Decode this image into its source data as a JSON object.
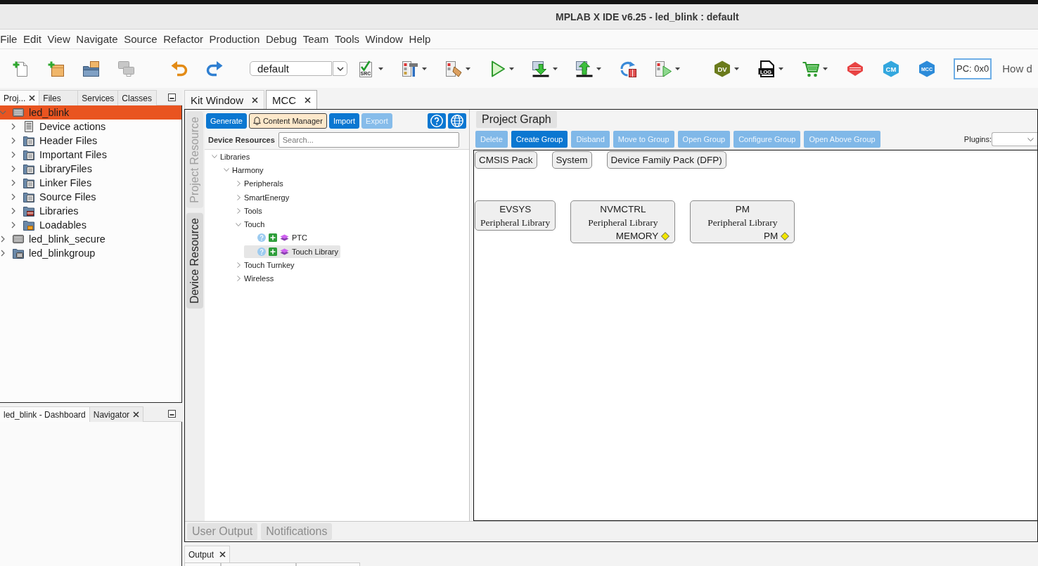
{
  "window": {
    "title": "MPLAB X IDE v6.25 - led_blink : default"
  },
  "menu": [
    "File",
    "Edit",
    "View",
    "Navigate",
    "Source",
    "Refactor",
    "Production",
    "Debug",
    "Team",
    "Tools",
    "Window",
    "Help"
  ],
  "toolbar": {
    "groups": [
      [
        {
          "kind": "new-file",
          "menu": false,
          "disabled": false
        },
        {
          "kind": "new-project",
          "menu": false,
          "disabled": false
        },
        {
          "kind": "open-project",
          "menu": false,
          "disabled": false
        },
        {
          "kind": "close-project",
          "menu": false,
          "disabled": true
        }
      ],
      [
        {
          "kind": "undo",
          "menu": false,
          "disabled": false
        },
        {
          "kind": "redo",
          "menu": false,
          "disabled": false
        }
      ],
      [
        {
          "kind": "check-source",
          "glyph": "SRC",
          "menu": true,
          "disabled": false
        },
        {
          "kind": "build",
          "menu": true,
          "disabled": false
        },
        {
          "kind": "clean-build",
          "menu": true,
          "disabled": false
        },
        {
          "kind": "run",
          "menu": true,
          "disabled": false
        },
        {
          "kind": "program-device",
          "menu": true,
          "disabled": false
        },
        {
          "kind": "read-device",
          "menu": true,
          "disabled": false
        },
        {
          "kind": "reset",
          "menu": false,
          "disabled": false
        },
        {
          "kind": "step",
          "menu": true,
          "disabled": false
        }
      ],
      [
        {
          "kind": "badge",
          "glyph": "DV",
          "color": "#6b7b1c",
          "menu": true,
          "disabled": false
        },
        {
          "kind": "log",
          "glyph": "LOG",
          "menu": true,
          "disabled": false
        },
        {
          "kind": "cart",
          "menu": true,
          "disabled": false
        },
        {
          "kind": "discover",
          "menu": false,
          "disabled": false
        },
        {
          "kind": "badge",
          "glyph": "CM",
          "color": "#33a7de",
          "menu": false,
          "disabled": false
        },
        {
          "kind": "badge",
          "glyph": "MCC",
          "color": "#2c8bd9",
          "menu": false,
          "disabled": false
        }
      ]
    ],
    "configuration": "default",
    "pc_readout": "PC: 0x0",
    "search": {
      "placeholder": "How d"
    }
  },
  "projects_panel": {
    "tabs": [
      {
        "label": "Proj...",
        "selected": true,
        "closable": true
      },
      {
        "label": "Files",
        "selected": false,
        "closable": false
      },
      {
        "label": "Services",
        "selected": false,
        "closable": false
      },
      {
        "label": "Classes",
        "selected": false,
        "closable": false
      }
    ],
    "tree": [
      {
        "label": "led_blink",
        "kind": "project",
        "expanded": true,
        "selected": true,
        "children": [
          {
            "label": "Device actions",
            "kind": "actions",
            "expanded": false,
            "selected": false
          },
          {
            "label": "Header Files",
            "kind": "folder",
            "expanded": false,
            "selected": false
          },
          {
            "label": "Important Files",
            "kind": "folder",
            "expanded": false,
            "selected": false
          },
          {
            "label": "LibraryFiles",
            "kind": "folder",
            "expanded": false,
            "selected": false
          },
          {
            "label": "Linker Files",
            "kind": "folder",
            "expanded": false,
            "selected": false
          },
          {
            "label": "Source Files",
            "kind": "folder",
            "expanded": false,
            "selected": false
          },
          {
            "label": "Libraries",
            "kind": "libraries",
            "expanded": false,
            "selected": false
          },
          {
            "label": "Loadables",
            "kind": "loadables",
            "expanded": false,
            "selected": false
          }
        ]
      },
      {
        "label": "led_blink_secure",
        "kind": "project",
        "expanded": false,
        "selected": false
      },
      {
        "label": "led_blinkgroup",
        "kind": "group",
        "expanded": false,
        "selected": false
      }
    ]
  },
  "dashboard_panel": {
    "tabs": [
      {
        "label": "led_blink - Dashboard",
        "selected": true,
        "closable": false
      },
      {
        "label": "Navigator",
        "selected": false,
        "closable": true
      }
    ]
  },
  "editor": {
    "tabs": [
      {
        "label": "Kit Window",
        "selected": false,
        "closable": true
      },
      {
        "label": "MCC",
        "selected": true,
        "closable": true
      }
    ]
  },
  "mcc": {
    "side_tabs": [
      {
        "label": "Project Resource",
        "selected": false
      },
      {
        "label": "Device Resource",
        "selected": true
      }
    ],
    "resource_buttons": [
      {
        "label": "Generate",
        "kind": "primary",
        "disabled": false
      },
      {
        "label": "Content Manager",
        "kind": "notice",
        "disabled": false
      },
      {
        "label": "Import",
        "kind": "primary",
        "disabled": false
      },
      {
        "label": "Export",
        "kind": "primary",
        "disabled": true
      }
    ],
    "device_resources": {
      "label": "Device Resources",
      "search": {
        "placeholder": "Search..."
      }
    },
    "library_tree": [
      {
        "label": "Libraries",
        "kind": "category",
        "expanded": true,
        "selected": false,
        "children": [
          {
            "label": "Harmony",
            "kind": "category",
            "expanded": true,
            "selected": false,
            "children": [
              {
                "label": "Peripherals",
                "kind": "category",
                "expanded": false,
                "selected": false
              },
              {
                "label": "SmartEnergy",
                "kind": "category",
                "expanded": false,
                "selected": false
              },
              {
                "label": "Tools",
                "kind": "category",
                "expanded": false,
                "selected": false
              },
              {
                "label": "Touch",
                "kind": "category",
                "expanded": true,
                "selected": false,
                "children": [
                  {
                    "label": "PTC",
                    "kind": "component",
                    "selected": false
                  },
                  {
                    "label": "Touch Library",
                    "kind": "component",
                    "selected": true
                  }
                ]
              },
              {
                "label": "Touch Turnkey",
                "kind": "category",
                "expanded": false,
                "selected": false
              },
              {
                "label": "Wireless",
                "kind": "category",
                "expanded": false,
                "selected": false
              }
            ]
          }
        ]
      }
    ],
    "graph": {
      "title": "Project Graph",
      "actions": [
        {
          "label": "Delete",
          "disabled": true
        },
        {
          "label": "Create Group",
          "disabled": false
        },
        {
          "label": "Disband",
          "disabled": true
        },
        {
          "label": "Move to Group",
          "disabled": true
        },
        {
          "label": "Open Group",
          "disabled": true
        },
        {
          "label": "Configure Group",
          "disabled": true
        },
        {
          "label": "Open Above Group",
          "disabled": true
        }
      ],
      "plugins_label": "Plugins:",
      "packs": [
        "CMSIS Pack",
        "System",
        "Device Family Pack (DFP)"
      ],
      "components": [
        {
          "name": "EVSYS",
          "subtitle": "Peripheral Library"
        },
        {
          "name": "NVMCTRL",
          "subtitle": "Peripheral Library",
          "port": "MEMORY"
        },
        {
          "name": "PM",
          "subtitle": "Peripheral Library",
          "port": "PM"
        }
      ]
    },
    "output_tabs": [
      {
        "label": "User Output",
        "selected": false
      },
      {
        "label": "Notifications",
        "selected": false
      }
    ]
  },
  "output_panel": {
    "tabs": [
      {
        "label": "Output",
        "selected": true,
        "closable": true
      }
    ]
  }
}
